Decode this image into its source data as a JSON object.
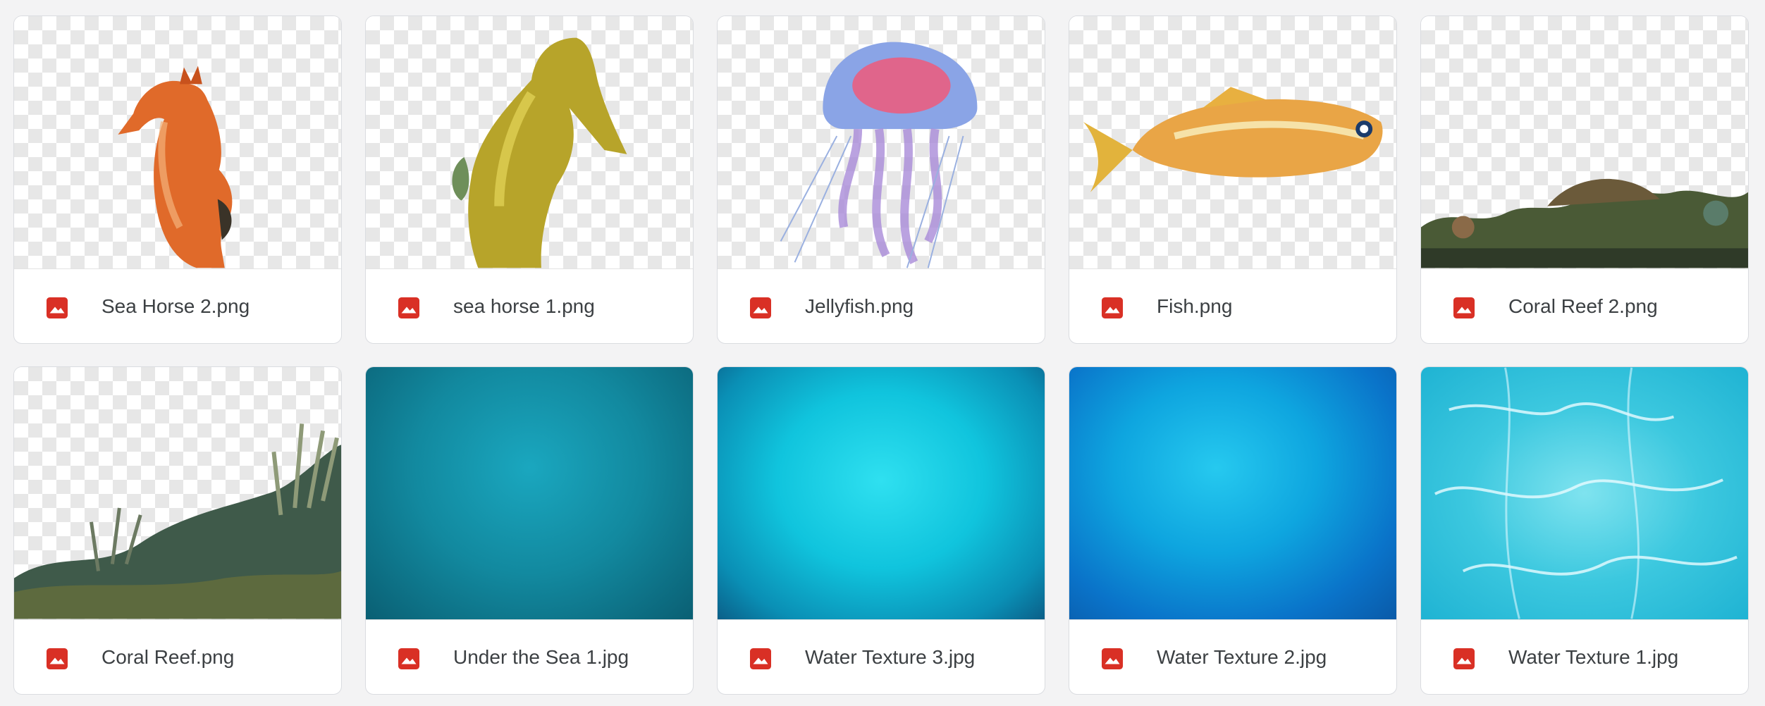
{
  "files": [
    {
      "name": "Sea Horse 2.png",
      "icon": "image-file-icon",
      "preview": "orange-seahorse"
    },
    {
      "name": "sea horse 1.png",
      "icon": "image-file-icon",
      "preview": "yellow-seahorse"
    },
    {
      "name": "Jellyfish.png",
      "icon": "image-file-icon",
      "preview": "jellyfish"
    },
    {
      "name": "Fish.png",
      "icon": "image-file-icon",
      "preview": "fish"
    },
    {
      "name": "Coral Reef 2.png",
      "icon": "image-file-icon",
      "preview": "coral-reef-strip"
    },
    {
      "name": "Coral Reef.png",
      "icon": "image-file-icon",
      "preview": "coral-reef"
    },
    {
      "name": "Under the Sea 1.jpg",
      "icon": "image-file-icon",
      "preview": "deep-teal-texture"
    },
    {
      "name": "Water Texture 3.jpg",
      "icon": "image-file-icon",
      "preview": "cyan-grunge-texture"
    },
    {
      "name": "Water Texture 2.jpg",
      "icon": "image-file-icon",
      "preview": "blue-water-texture"
    },
    {
      "name": "Water Texture 1.jpg",
      "icon": "image-file-icon",
      "preview": "caustics-water-texture"
    }
  ],
  "colors": {
    "icon_red": "#d93025",
    "card_border": "#dadce0",
    "text": "#3c4043",
    "background": "#f3f3f4"
  }
}
